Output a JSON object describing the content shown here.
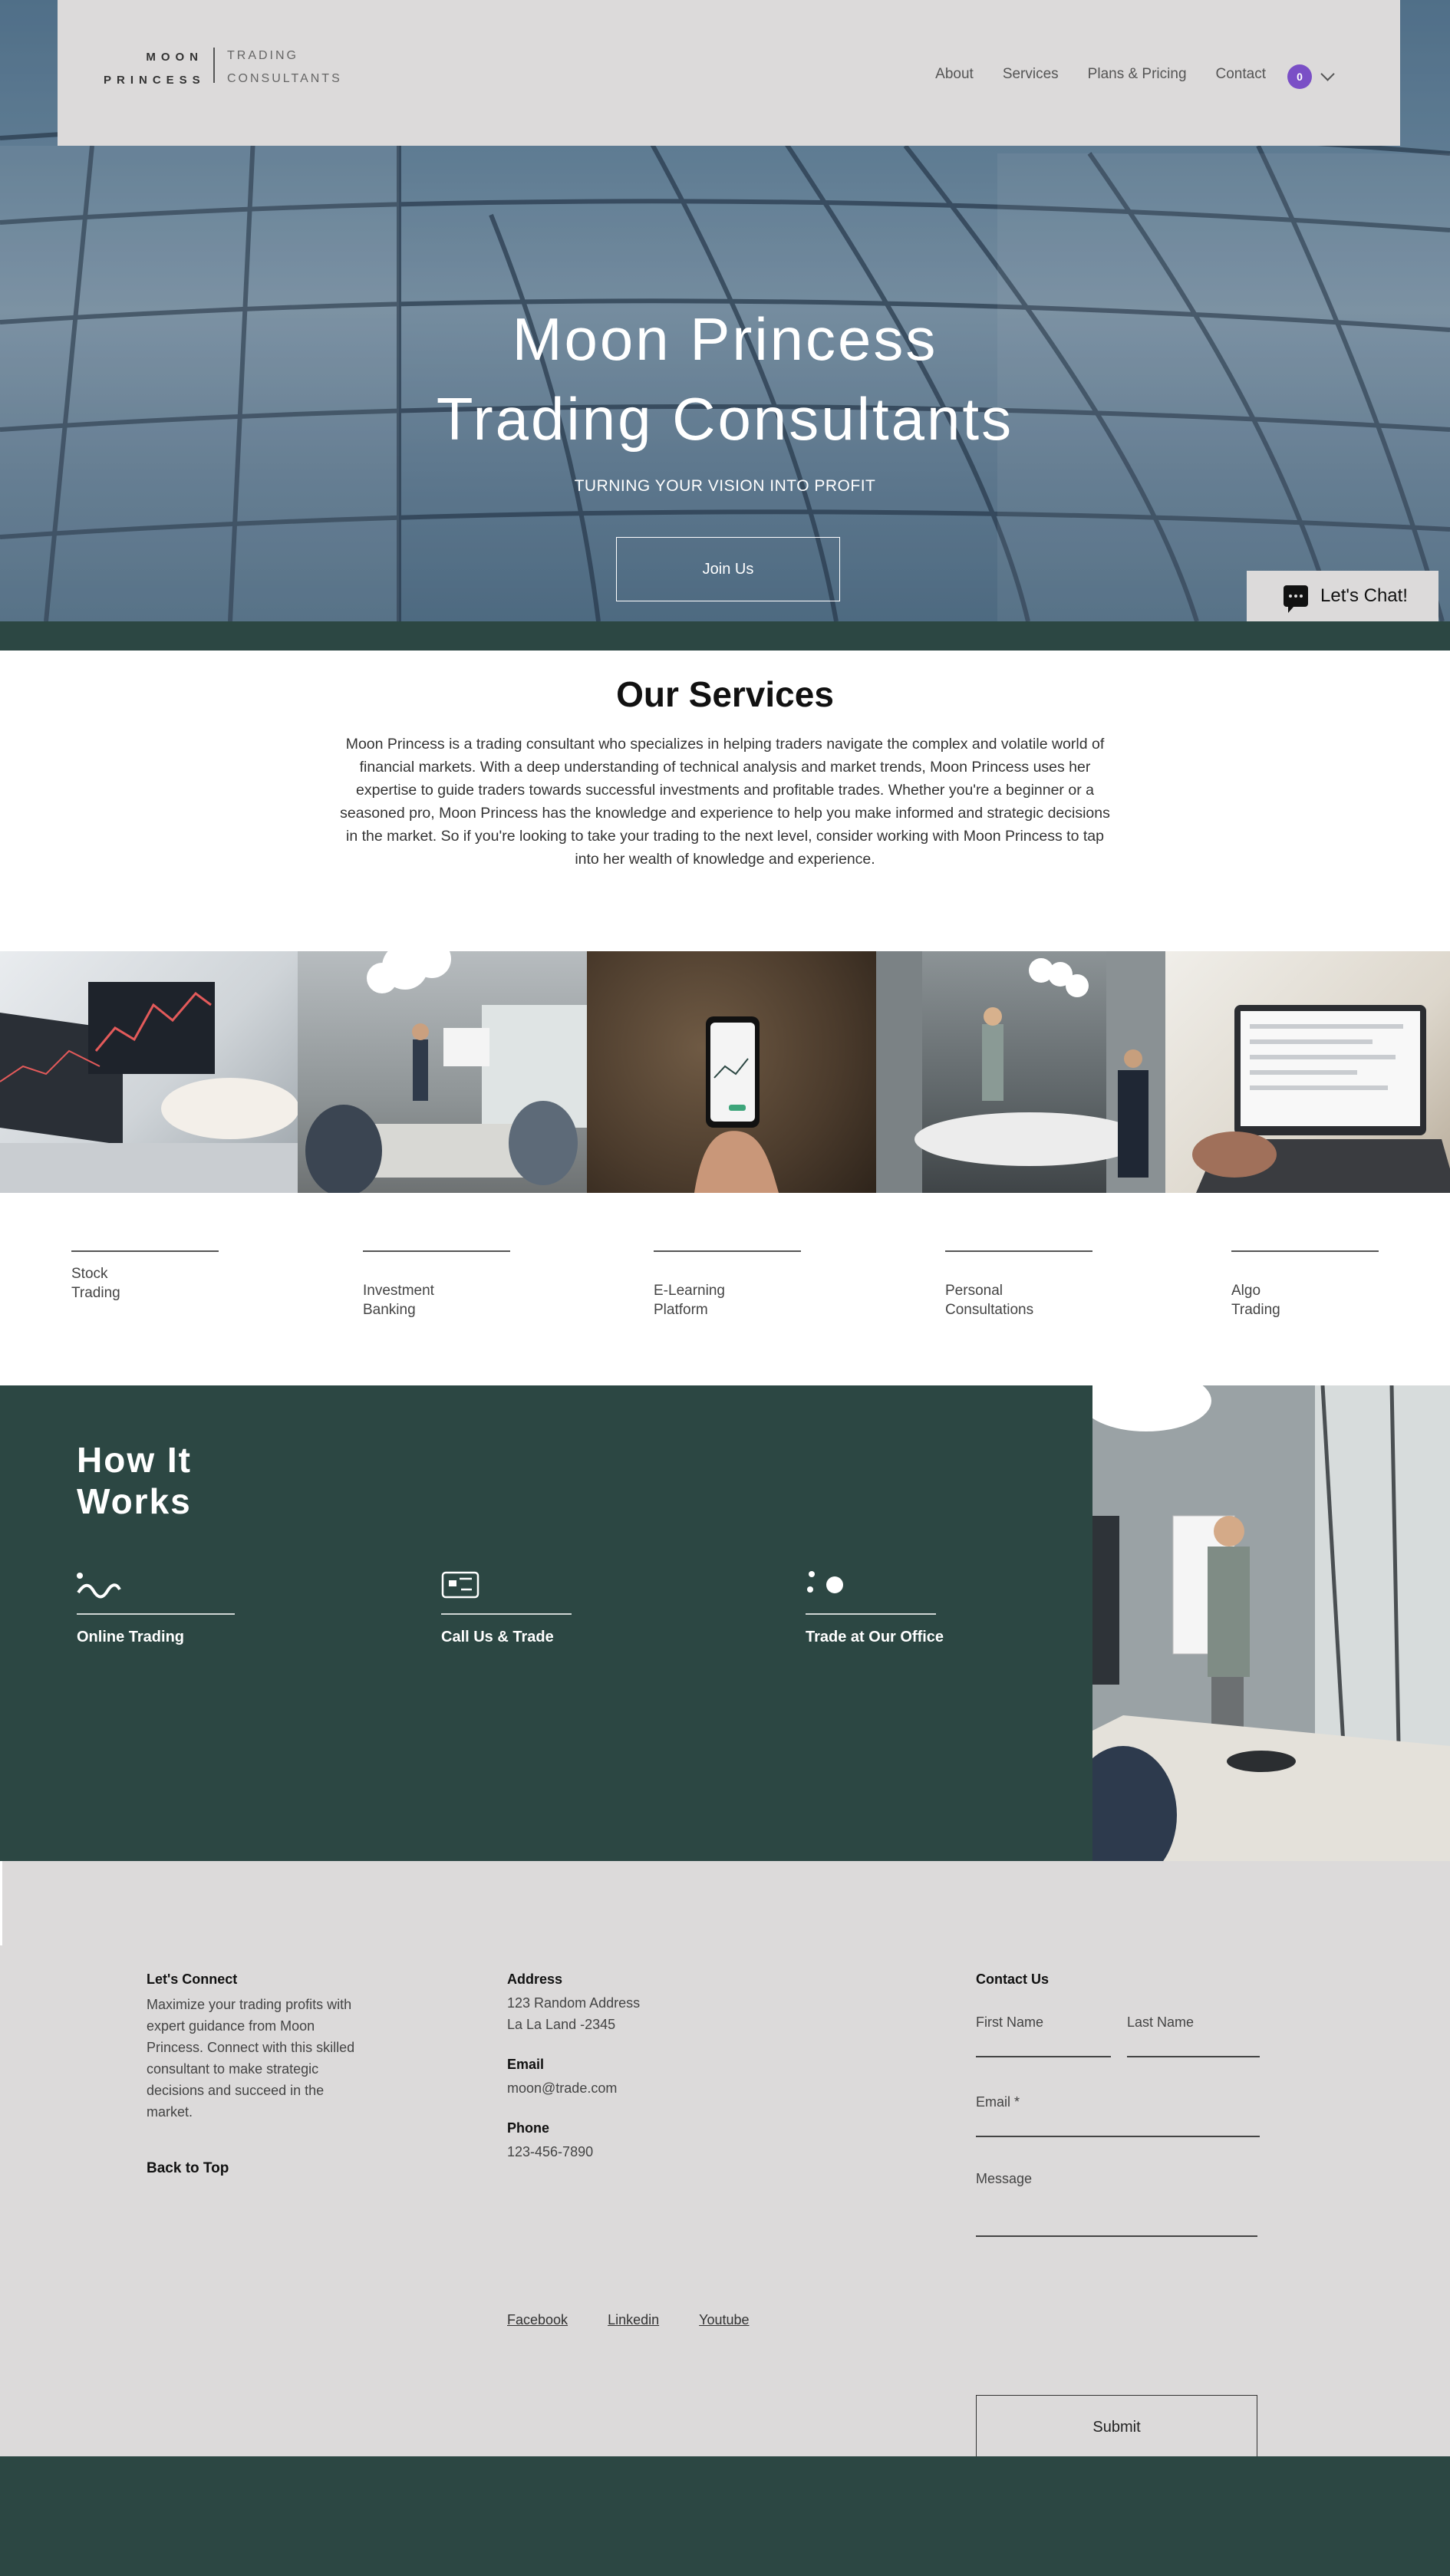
{
  "header": {
    "logo_line1": "MOON",
    "logo_line2": "PRINCESS",
    "logo_right1": "TRADING",
    "logo_right2": "CONSULTANTS",
    "nav": [
      "About",
      "Services",
      "Plans & Pricing",
      "Contact"
    ],
    "cart_count": "0"
  },
  "hero": {
    "title_line1": "Moon Princess",
    "title_line2": "Trading Consultants",
    "subtitle": "TURNING YOUR VISION INTO PROFIT",
    "cta": "Join Us"
  },
  "chat": {
    "label": "Let's Chat!"
  },
  "services": {
    "title": "Our Services",
    "description": "Moon Princess is a trading consultant who specializes in helping traders navigate the complex and volatile world of financial markets. With a deep understanding of technical analysis and market trends, Moon Princess uses her expertise to guide traders towards successful investments and profitable trades. Whether you're a beginner or a seasoned pro, Moon Princess has the knowledge and experience to help you make informed and strategic decisions in the market. So if you're looking to take your trading to the next level, consider working with Moon Princess to tap into her wealth of knowledge and experience.",
    "items": [
      "Stock\nTrading",
      "Investment\nBanking",
      "E-Learning\nPlatform",
      "Personal\nConsultations",
      "Algo\nTrading"
    ]
  },
  "how": {
    "title": "How It\nWorks",
    "steps": [
      "Online Trading",
      "Call Us & Trade",
      "Trade at Our Office"
    ]
  },
  "footer": {
    "connect_title": "Let's Connect",
    "connect_text": "Maximize your trading profits with expert guidance from Moon Princess. Connect with this skilled consultant to make strategic decisions and succeed in the market.",
    "back_to_top": "Back to Top",
    "address_title": "Address",
    "address_line1": "123 Random Address",
    "address_line2": "La La Land -2345",
    "email_title": "Email",
    "email": "moon@trade.com",
    "phone_title": "Phone",
    "phone": "123-456-7890",
    "socials": [
      "Facebook",
      "Linkedin",
      "Youtube"
    ],
    "contact_title": "Contact Us",
    "first_name": "First Name",
    "last_name": "Last Name",
    "email_field": "Email *",
    "message": "Message",
    "submit": "Submit"
  }
}
